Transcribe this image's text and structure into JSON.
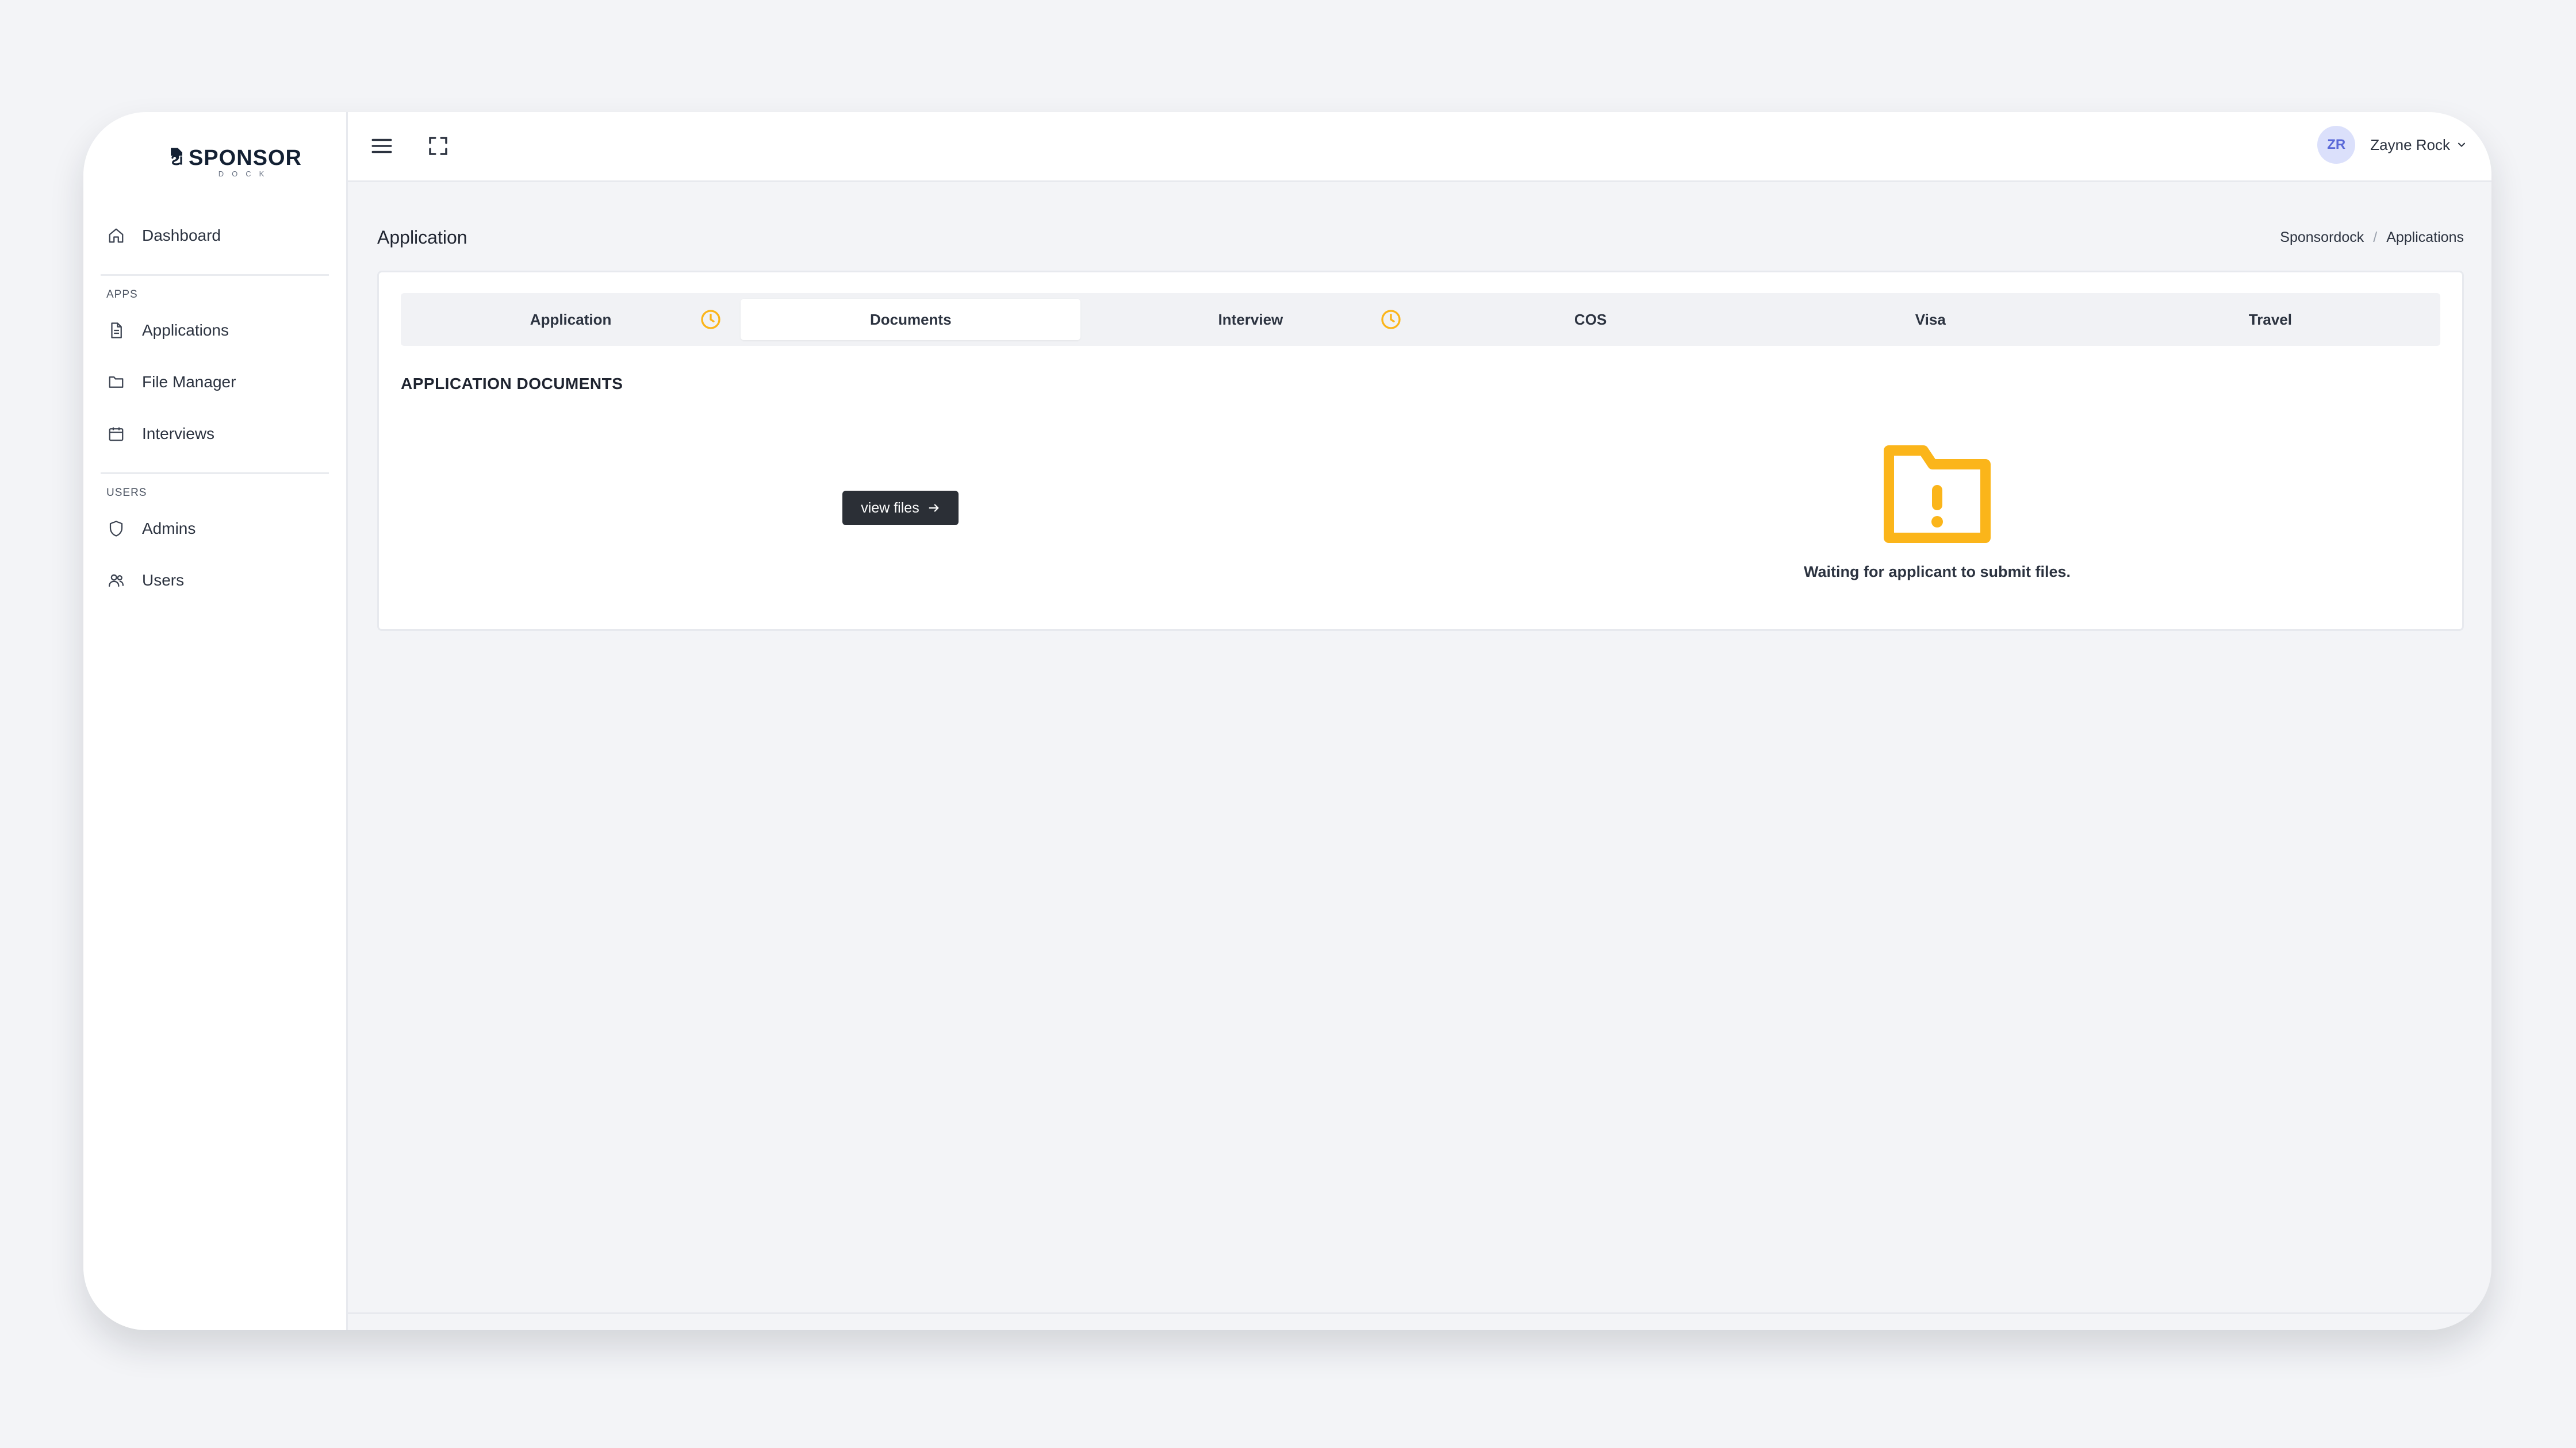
{
  "brand": {
    "name": "SPONSOR",
    "sub": "DOCK"
  },
  "sidebar": {
    "dashboard": "Dashboard",
    "apps_heading": "APPS",
    "apps": [
      "Applications",
      "File Manager",
      "Interviews"
    ],
    "users_heading": "USERS",
    "users": [
      "Admins",
      "Users"
    ]
  },
  "topbar": {
    "user_initials": "ZR",
    "user_name": "Zayne Rock"
  },
  "page": {
    "title": "Application",
    "breadcrumb": [
      "Sponsordock",
      "Applications"
    ]
  },
  "tabs": [
    {
      "label": "Application",
      "pending": true
    },
    {
      "label": "Documents",
      "active": true
    },
    {
      "label": "Interview",
      "pending": true
    },
    {
      "label": "COS"
    },
    {
      "label": "Visa"
    },
    {
      "label": "Travel"
    }
  ],
  "documents": {
    "section_title": "APPLICATION DOCUMENTS",
    "view_files_label": "view files",
    "empty_message": "Waiting for applicant to submit files."
  },
  "colors": {
    "accent_warning": "#fbb51a",
    "avatar_bg": "#dbe0fb",
    "avatar_fg": "#5a69d8",
    "button_dark": "#2b2f36"
  }
}
